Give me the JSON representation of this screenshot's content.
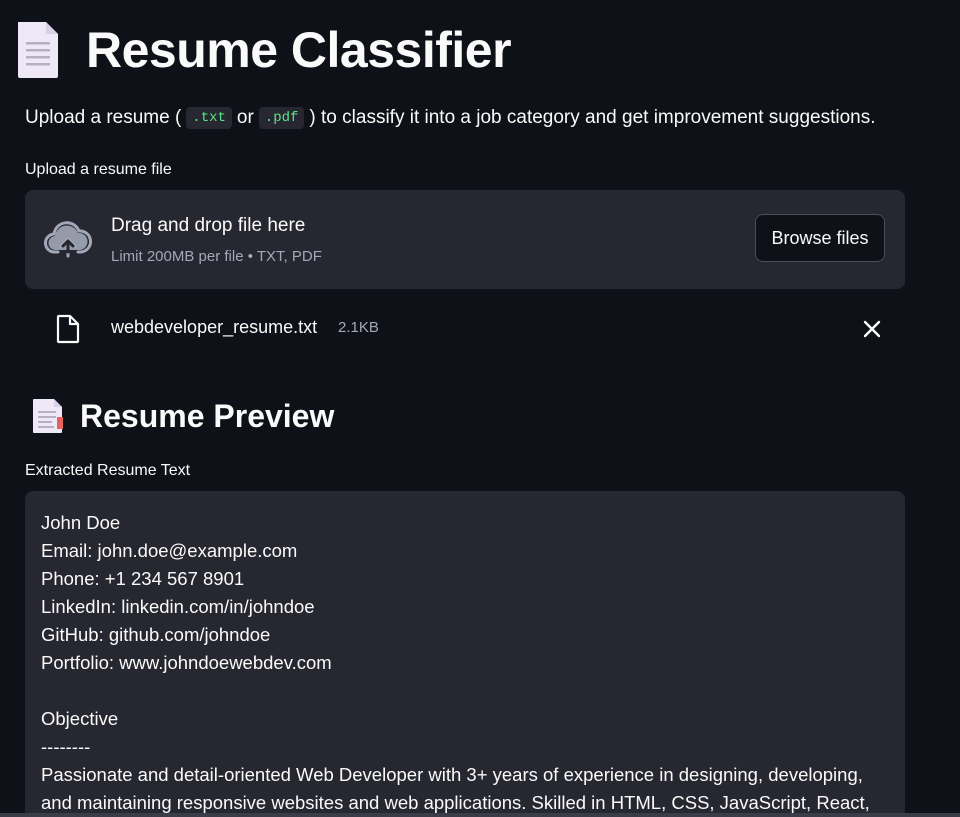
{
  "header": {
    "title": "Resume Classifier",
    "subtitle_before": "Upload a resume (",
    "ext_txt": ".txt",
    "subtitle_or": "or",
    "ext_pdf": ".pdf",
    "subtitle_after": ") to classify it into a job category and get improvement suggestions."
  },
  "uploader": {
    "label": "Upload a resume file",
    "drop_text": "Drag and drop file here",
    "limit_text": "Limit 200MB per file • TXT, PDF",
    "browse_label": "Browse files",
    "icon": "cloud-upload-icon"
  },
  "uploaded_file": {
    "name": "webdeveloper_resume.txt",
    "size": "2.1KB",
    "icon": "file-icon"
  },
  "preview": {
    "title": "Resume Preview",
    "textarea_label": "Extracted Resume Text",
    "text": "John Doe\nEmail: john.doe@example.com\nPhone: +1 234 567 8901\nLinkedIn: linkedin.com/in/johndoe\nGitHub: github.com/johndoe\nPortfolio: www.johndoewebdev.com\n\nObjective\n--------\nPassionate and detail-oriented Web Developer with 3+ years of experience in designing, developing, and maintaining responsive websites and web applications. Skilled in HTML, CSS, JavaScript, React,"
  },
  "colors": {
    "background": "#0e1117",
    "panel": "#262730",
    "text": "#fafafa",
    "muted": "#a3a8b8",
    "code": "#5ce488"
  }
}
